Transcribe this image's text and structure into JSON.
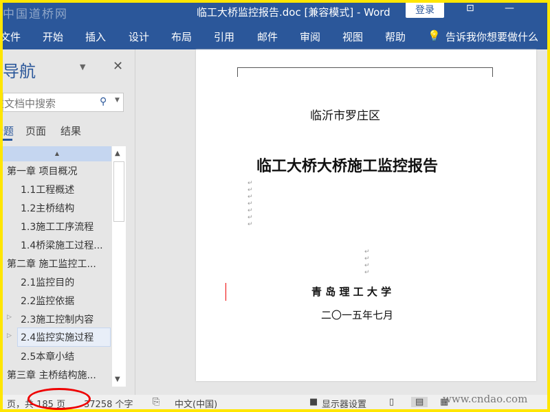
{
  "titlebar": {
    "logo": "中国道桥网",
    "title": "临工大桥监控报告.doc [兼容模式]  -  Word",
    "login": "登录",
    "restore_icon": "ribbon-display-icon",
    "minimize": "—"
  },
  "ribbon": {
    "tabs": [
      "文件",
      "开始",
      "插入",
      "设计",
      "布局",
      "引用",
      "邮件",
      "审阅",
      "视图",
      "帮助"
    ],
    "tell_me": "告诉我你想要做什么"
  },
  "nav": {
    "title": "导航",
    "search_placeholder": "在文档中搜索",
    "tabs": [
      "标题",
      "页面",
      "结果"
    ],
    "items": [
      "第一章  项目概况",
      "1.1工程概述",
      "1.2主桥结构",
      "1.3施工工序流程",
      "1.4桥梁施工过程...",
      "第二章  施工监控工...",
      "2.1监控目的",
      "2.2监控依据",
      "2.3施工控制内容",
      "2.4监控实施过程",
      "2.5本章小结",
      "第三章  主桥结构施..."
    ]
  },
  "document": {
    "subtitle": "临沂市罗庄区",
    "title": "临工大桥大桥施工监控报告",
    "org": "青 岛 理 工 大 学",
    "date": "二〇一五年七月"
  },
  "status": {
    "page": "页，共 185 页",
    "words": "37258 个字",
    "language": "中文(中国)",
    "display": "显示器设置"
  },
  "watermark": "www.cndao.com",
  "colors": {
    "accent": "#2b579a",
    "highlight_circle": "#e00000",
    "border": "#ffe600"
  }
}
